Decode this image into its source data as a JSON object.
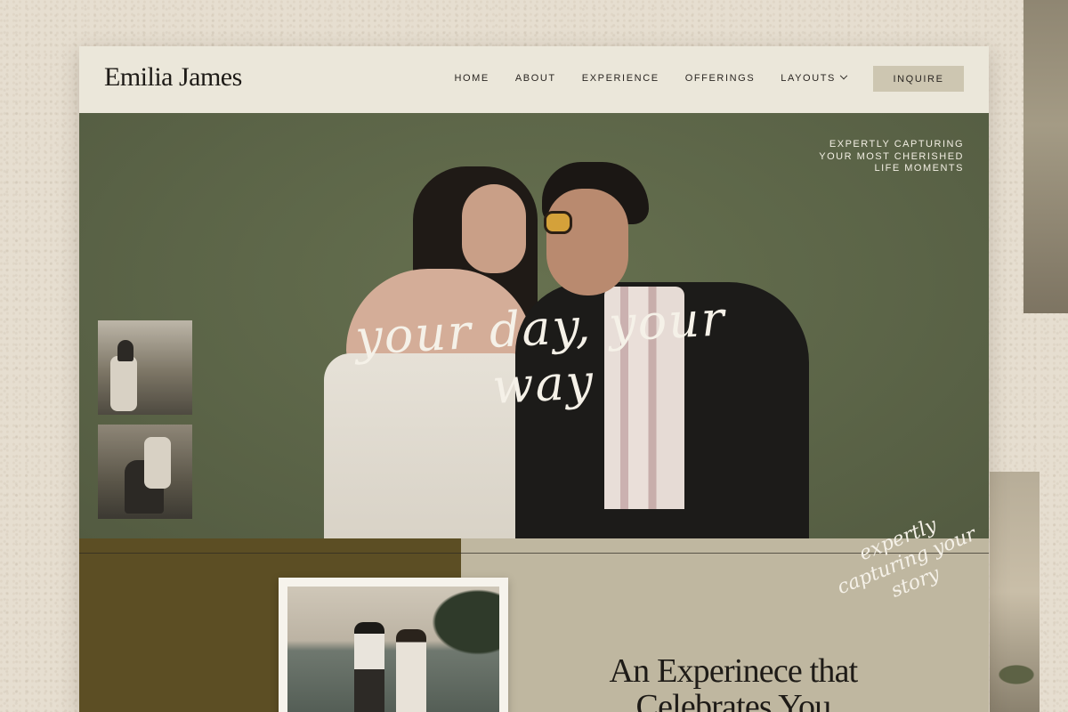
{
  "brand": {
    "name": "Emilia James"
  },
  "nav": {
    "items": [
      {
        "label": "HOME"
      },
      {
        "label": "ABOUT"
      },
      {
        "label": "EXPERIENCE"
      },
      {
        "label": "OFFERINGS"
      },
      {
        "label": "LAYOUTS"
      }
    ],
    "inquire_label": "INQUIRE"
  },
  "hero": {
    "tagline_lines": [
      "EXPERTLY CAPTURING",
      "YOUR MOST CHERISHED",
      "LIFE MOMENTS"
    ],
    "script": "your day, your way"
  },
  "lower": {
    "side_script_lines": [
      "expertly",
      "capturing your",
      "story"
    ],
    "heading_lines": [
      "An Experinece that",
      "Celebrates You"
    ]
  },
  "colors": {
    "header_bg": "#ebe7da",
    "hero_bg": "#5c6548",
    "lower_left_bg": "#5c4e24",
    "lower_right_bg": "#bfb7a0",
    "inquire_bg": "#cdc6b1"
  }
}
